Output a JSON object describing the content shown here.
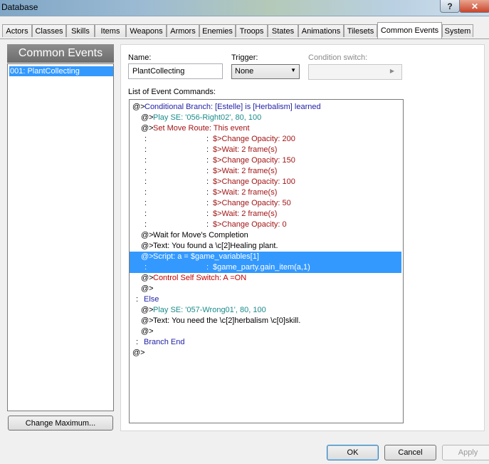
{
  "window": {
    "title": "Database",
    "help_glyph": "?",
    "close_glyph": "✕"
  },
  "tabs": [
    {
      "label": "Actors"
    },
    {
      "label": "Classes"
    },
    {
      "label": "Skills"
    },
    {
      "label": "Items"
    },
    {
      "label": "Weapons"
    },
    {
      "label": "Armors"
    },
    {
      "label": "Enemies"
    },
    {
      "label": "Troops"
    },
    {
      "label": "States"
    },
    {
      "label": "Animations"
    },
    {
      "label": "Tilesets"
    },
    {
      "label": "Common Events",
      "active": true
    },
    {
      "label": "System"
    }
  ],
  "left_panel": {
    "header": "Common Events",
    "items": [
      "001: PlantCollecting"
    ],
    "change_max_label": "Change Maximum..."
  },
  "form": {
    "name_label": "Name:",
    "name_value": "PlantCollecting",
    "trigger_label": "Trigger:",
    "trigger_value": "None",
    "condition_label": "Condition switch:",
    "list_label": "List of Event Commands:"
  },
  "commands": [
    {
      "parts": [
        {
          "t": "@>",
          "c": "#000"
        },
        {
          "t": "Conditional Branch: [Estelle] is [Herbalism] learned",
          "c": "#1f1fa6"
        }
      ]
    },
    {
      "parts": [
        {
          "t": "@>",
          "c": "#000"
        },
        {
          "t": "Play SE: '056-Right02', 80, 100",
          "c": "#1a8b8b"
        }
      ]
    },
    {
      "parts": [
        {
          "t": "@>",
          "c": "#000"
        },
        {
          "t": "Set Move Route: This event",
          "c": "#a31515"
        }
      ]
    },
    {
      "parts": [
        {
          "t": ":",
          "c": "#000"
        },
        {
          "t": ":",
          "c": "#000"
        },
        {
          "t": "$>Change Opacity: 200",
          "c": "#a31515"
        }
      ]
    },
    {
      "parts": [
        {
          "t": ":",
          "c": "#000"
        },
        {
          "t": ":",
          "c": "#000"
        },
        {
          "t": "$>Wait: 2 frame(s)",
          "c": "#a31515"
        }
      ]
    },
    {
      "parts": [
        {
          "t": ":",
          "c": "#000"
        },
        {
          "t": ":",
          "c": "#000"
        },
        {
          "t": "$>Change Opacity: 150",
          "c": "#a31515"
        }
      ]
    },
    {
      "parts": [
        {
          "t": ":",
          "c": "#000"
        },
        {
          "t": ":",
          "c": "#000"
        },
        {
          "t": "$>Wait: 2 frame(s)",
          "c": "#a31515"
        }
      ]
    },
    {
      "parts": [
        {
          "t": ":",
          "c": "#000"
        },
        {
          "t": ":",
          "c": "#000"
        },
        {
          "t": "$>Change Opacity: 100",
          "c": "#a31515"
        }
      ]
    },
    {
      "parts": [
        {
          "t": ":",
          "c": "#000"
        },
        {
          "t": ":",
          "c": "#000"
        },
        {
          "t": "$>Wait: 2 frame(s)",
          "c": "#a31515"
        }
      ]
    },
    {
      "parts": [
        {
          "t": ":",
          "c": "#000"
        },
        {
          "t": ":",
          "c": "#000"
        },
        {
          "t": "$>Change Opacity: 50",
          "c": "#a31515"
        }
      ]
    },
    {
      "parts": [
        {
          "t": ":",
          "c": "#000"
        },
        {
          "t": ":",
          "c": "#000"
        },
        {
          "t": "$>Wait: 2 frame(s)",
          "c": "#a31515"
        }
      ]
    },
    {
      "parts": [
        {
          "t": ":",
          "c": "#000"
        },
        {
          "t": ":",
          "c": "#000"
        },
        {
          "t": "$>Change Opacity: 0",
          "c": "#a31515"
        }
      ]
    },
    {
      "parts": [
        {
          "t": "@>",
          "c": "#000"
        },
        {
          "t": "Wait for Move's Completion",
          "c": "#000"
        }
      ]
    },
    {
      "parts": [
        {
          "t": "@>",
          "c": "#000"
        },
        {
          "t": "Text: You found a \\c[2]Healing plant.",
          "c": "#000"
        }
      ]
    },
    {
      "selected": true,
      "parts": [
        {
          "t": "@>",
          "c": "#ffffff"
        },
        {
          "t": "Script: a = $game_variables[1]",
          "c": "#ffffff"
        }
      ]
    },
    {
      "selected": true,
      "parts": [
        {
          "t": ":",
          "c": "#ffffff"
        },
        {
          "t": ":",
          "c": "#ffffff"
        },
        {
          "t": "$game_party.gain_item(a,1)",
          "c": "#ffffff"
        }
      ]
    },
    {
      "parts": [
        {
          "t": "@>",
          "c": "#000"
        },
        {
          "t": "Control Self Switch: A =ON",
          "c": "#c00000"
        }
      ]
    },
    {
      "parts": [
        {
          "t": "@>",
          "c": "#000"
        }
      ]
    },
    {
      "parts": [
        {
          "t": ":",
          "c": "#000"
        },
        {
          "t": "Else",
          "c": "#1f1fa6"
        }
      ]
    },
    {
      "parts": [
        {
          "t": "@>",
          "c": "#000"
        },
        {
          "t": "Play SE: '057-Wrong01', 80, 100",
          "c": "#1a8b8b"
        }
      ]
    },
    {
      "parts": [
        {
          "t": "@>",
          "c": "#000"
        },
        {
          "t": "Text: You need the \\c[2]herbalism \\c[0]skill.",
          "c": "#000"
        }
      ]
    },
    {
      "parts": [
        {
          "t": "@>",
          "c": "#000"
        }
      ]
    },
    {
      "parts": [
        {
          "t": ":",
          "c": "#000"
        },
        {
          "t": "Branch End",
          "c": "#1f1fa6"
        }
      ]
    },
    {
      "parts": [
        {
          "t": "@>",
          "c": "#000"
        }
      ]
    }
  ],
  "buttons": {
    "ok": "OK",
    "cancel": "Cancel",
    "apply": "Apply"
  }
}
